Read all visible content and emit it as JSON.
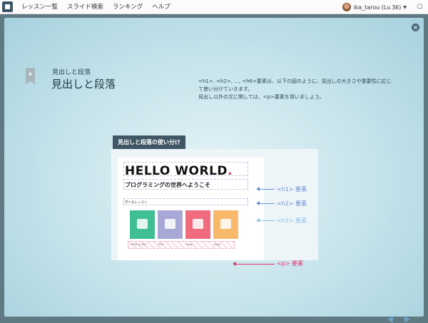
{
  "nav": {
    "items": [
      "レッスン一覧",
      "スライド検索",
      "ランキング",
      "ヘルプ"
    ]
  },
  "user": {
    "name": "ika_tarou (Lv.36)"
  },
  "slide": {
    "category": "見出しと段落",
    "title": "見出しと段落",
    "description": [
      "<h1>, <h2>, ..., <h6>要素は、以下の図のように、見出しの大きさや重要性に応じ",
      "て使い分けていきます。",
      "見出し以外の文に関しては、<p>要素を用いましょう。"
    ]
  },
  "figure": {
    "label": "見出しと段落の使い分け",
    "hello_text": "HELLO WORLD",
    "hello_dot": ".",
    "h2_text": "プログラミングの世界へようこそ",
    "h3_text": "学べるレッスン",
    "cards": [
      {
        "label": "HTML & CSS",
        "color": "#3fbf94"
      },
      {
        "label": "PHP",
        "color": "#a8a8d6"
      },
      {
        "label": "Ruby",
        "color": "#f06b7e"
      },
      {
        "label": "Swift",
        "color": "#f9b96b"
      }
    ],
    "annotations": {
      "h1": "<h1> 要素",
      "h2": "<h2> 要素",
      "h3": "<h3> 要素",
      "p": "<p> 要素"
    }
  },
  "colors": {
    "h1_annotation": "#6a8fd0",
    "h2_annotation": "#6a8fd0",
    "h3_annotation": "#8fc2e8",
    "p_annotation": "#e6336f",
    "accent_dot": "#e6315b"
  }
}
